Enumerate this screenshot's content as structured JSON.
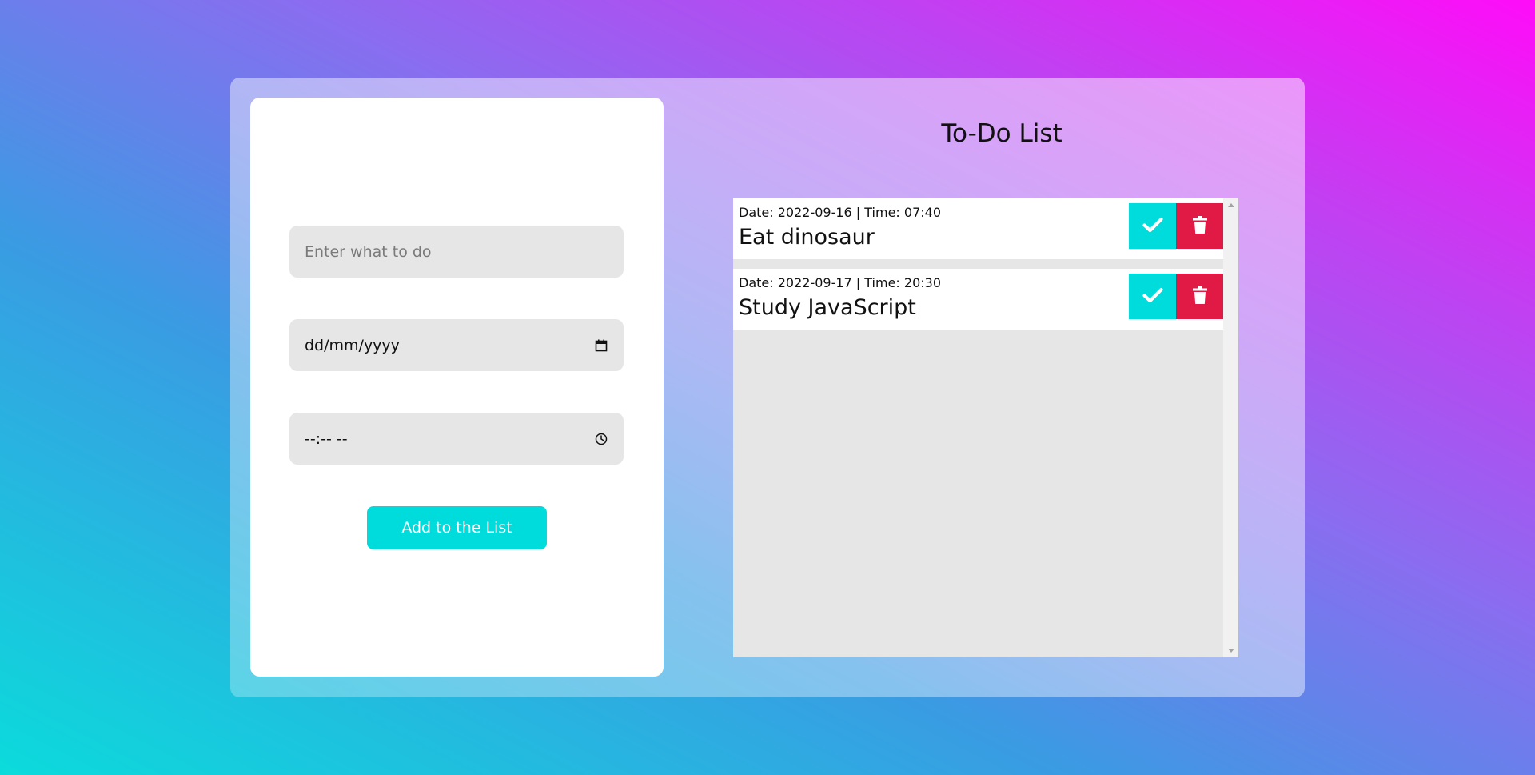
{
  "form": {
    "task_placeholder": "Enter what to do",
    "date_placeholder": "dd/mm/yyyy",
    "time_placeholder": "--:-- --",
    "add_button_label": "Add to the List"
  },
  "list": {
    "title": "To-Do List",
    "items": [
      {
        "meta": "Date: 2022-09-16 | Time: 07:40",
        "name": "Eat dinosaur"
      },
      {
        "meta": "Date: 2022-09-17 | Time: 20:30",
        "name": "Study JavaScript"
      }
    ]
  },
  "colors": {
    "accent": "#00dcdc",
    "danger": "#e01a45",
    "field_bg": "#e6e6e6"
  },
  "icons": {
    "calendar": "calendar-icon",
    "clock": "clock-icon",
    "check": "check-icon",
    "trash": "trash-icon"
  }
}
